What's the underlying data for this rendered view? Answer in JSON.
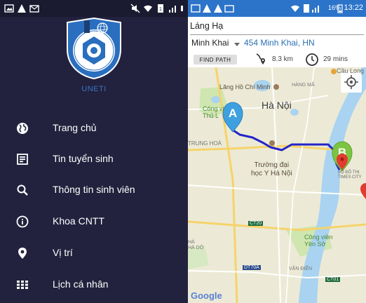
{
  "drawer": {
    "brand": "UNETI",
    "logo_text": "TRƯỜNG ĐẠI HỌC KINH TẾ - KỸ THUẬT CÔNG NGHIỆP",
    "items": [
      {
        "label": "Trang chủ",
        "icon": "globe-icon"
      },
      {
        "label": "Tin tuyển sinh",
        "icon": "article-icon"
      },
      {
        "label": "Thông tin sinh viên",
        "icon": "search-icon"
      },
      {
        "label": "Khoa CNTT",
        "icon": "info-icon"
      },
      {
        "label": "Vị trí",
        "icon": "location-pin-icon"
      },
      {
        "label": "Lịch cá nhân",
        "icon": "grid-icon"
      }
    ]
  },
  "map_app": {
    "status_bar": {
      "battery": "16%",
      "time": "13:22"
    },
    "from_field": "Láng Hạ",
    "origin_select": "Minh Khai",
    "destination": "454 Minh Khai, HN",
    "find_button": "FIND PATH",
    "distance": "8.3 km",
    "duration": "29 mins",
    "map_labels": {
      "cau_long": "Cầu Long",
      "lang_ho_chi_minh": "Lăng Hồ Chí Minh",
      "hang_ma": "HÀNG MÃ",
      "cong_vien_thu_le": "Công vi\nThủ L",
      "ha_noi": "Hà Nội",
      "trung_hoa": "TRUNG HOÀ",
      "truong_dai_hoc_y_ha_noi": "Trường đại\nhọc Y Hà Nội",
      "bo_do_thi": "BỘ ĐÔ THỊ\nTIMES CITY",
      "ct20": "CT20",
      "cong_vien_yen_so": "Công viên\nYên Sở",
      "ha_dong": "HÀ\nHÀ DÔ",
      "dt70a": "DT70A",
      "van_dien": "VĂN ĐIỂN",
      "ct01": "CT01",
      "google": "Google",
      "marker_a": "A",
      "marker_b": "B"
    }
  },
  "colors": {
    "drawer_bg": "#22223e",
    "accent_blue": "#2c74c9",
    "route": "#2424c8",
    "marker_a": "#3fa0e0",
    "marker_b": "#7cc442",
    "brand_blue": "#3b73c0"
  }
}
